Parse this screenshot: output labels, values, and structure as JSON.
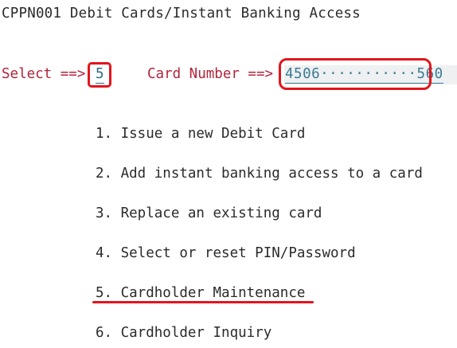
{
  "screen": {
    "title": "CPPN001 Debit Cards/Instant Banking Access"
  },
  "select": {
    "label": "Select ==>",
    "value": "5"
  },
  "card_number": {
    "label": "Card Number ==>",
    "value": "4506···········560"
  },
  "menu": {
    "items": [
      {
        "label": "1. Issue a new Debit Card"
      },
      {
        "label": "2. Add instant banking access to a card"
      },
      {
        "label": "3. Replace an existing card"
      },
      {
        "label": "4. Select or reset PIN/Password"
      },
      {
        "label": "5. Cardholder Maintenance"
      },
      {
        "label": "6. Cardholder Inquiry"
      }
    ]
  },
  "colors": {
    "label_red": "#b2243b",
    "field_text": "#2e6b83",
    "highlight_red": "#e2151c",
    "field_background": "#eef0f1"
  }
}
